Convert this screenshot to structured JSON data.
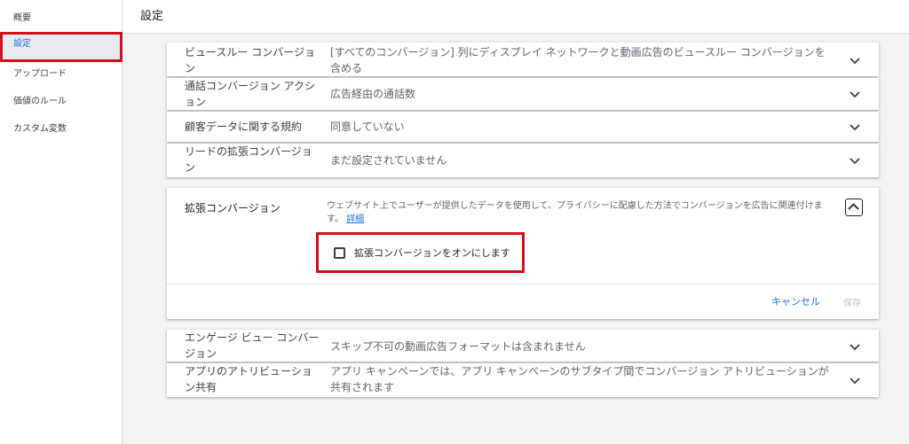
{
  "sidebar": {
    "items": [
      {
        "label": "概要"
      },
      {
        "label": "設定"
      },
      {
        "label": "アップロード"
      },
      {
        "label": "価値のルール"
      },
      {
        "label": "カスタム変数"
      }
    ]
  },
  "header": {
    "title": "設定"
  },
  "settings": {
    "rows_top": [
      {
        "label": "ビュースルー コンバージョン",
        "value": "[すべてのコンバージョン] 列にディスプレイ ネットワークと動画広告のビュースルー コンバージョンを含める"
      },
      {
        "label": "通話コンバージョン アクション",
        "value": "広告経由の通話数"
      },
      {
        "label": "顧客データに関する規約",
        "value": "同意していない"
      },
      {
        "label": "リードの拡張コンバージョン",
        "value": "まだ設定されていません"
      }
    ],
    "expanded": {
      "label": "拡張コンバージョン",
      "description": "ウェブサイト上でユーザーが提供したデータを使用して、プライバシーに配慮した方法でコンバージョンを広告に関連付けます。",
      "link": "詳細",
      "checkbox_label": "拡張コンバージョンをオンにします",
      "checkbox_checked": false,
      "cancel_label": "キャンセル",
      "save_label": "保存"
    },
    "rows_bottom": [
      {
        "label": "エンゲージ ビュー コンバージョン",
        "value": "スキップ不可の動画広告フォーマットは含まれません"
      },
      {
        "label": "アプリのアトリビューション共有",
        "value": "アプリ キャンペーンでは、アプリ キャンペーンのサブタイプ間でコンバージョン アトリビューションが共有されます"
      }
    ]
  },
  "colors": {
    "accent": "#1a73e8",
    "highlight": "#d0101a"
  }
}
